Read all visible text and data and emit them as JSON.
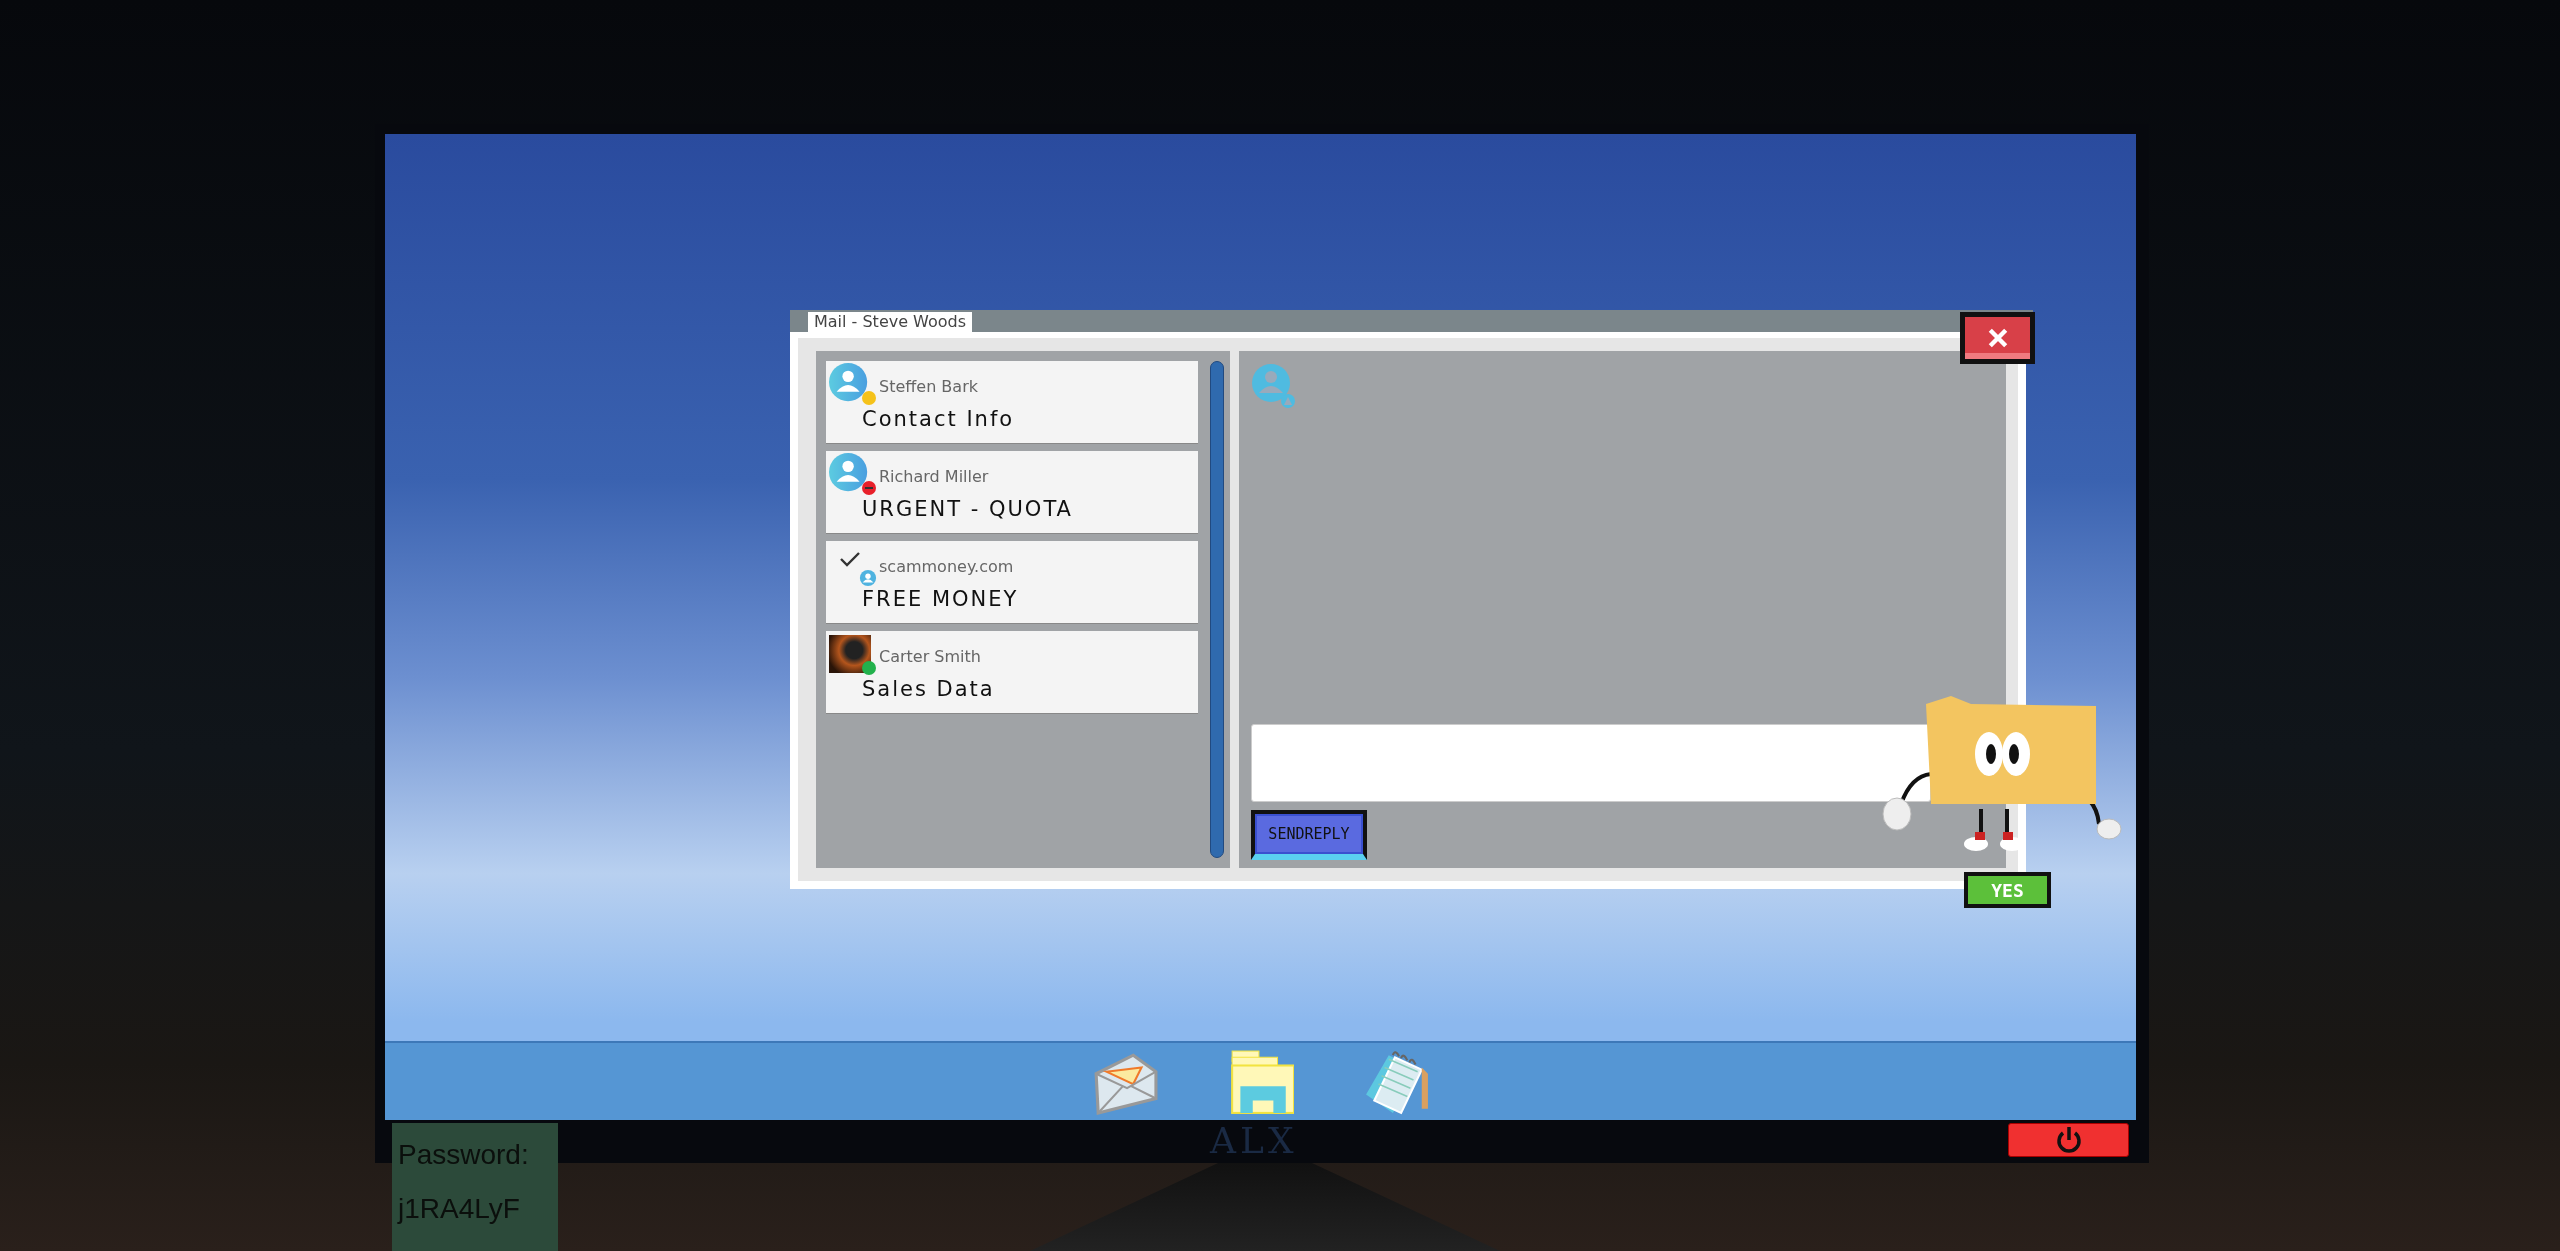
{
  "window": {
    "title": "Mail - Steve Woods"
  },
  "messages": [
    {
      "sender": "Steffen Bark",
      "subject": "Contact Info",
      "avatar": {
        "kind": "person"
      },
      "checked": false,
      "status": {
        "kind": "dot",
        "color": "#f5c21a"
      }
    },
    {
      "sender": "Richard Miller",
      "subject": "URGENT - QUOTA",
      "avatar": {
        "kind": "person"
      },
      "checked": false,
      "status": {
        "kind": "minus",
        "color": "#e8202a"
      }
    },
    {
      "sender": "scammoney.com",
      "subject": "FREE MONEY",
      "avatar": {
        "kind": "small"
      },
      "checked": true
    },
    {
      "sender": "Carter Smith",
      "subject": "Sales Data",
      "avatar": {
        "kind": "photo"
      },
      "checked": false,
      "status": {
        "kind": "dot",
        "color": "#22b14c"
      }
    }
  ],
  "send_button": "SENDREPLY",
  "assistant": {
    "button": "YES"
  },
  "monitor": {
    "brand": "ALX"
  },
  "sticky_note": {
    "lines": [
      "Password:",
      "j1RA4LyF"
    ]
  }
}
